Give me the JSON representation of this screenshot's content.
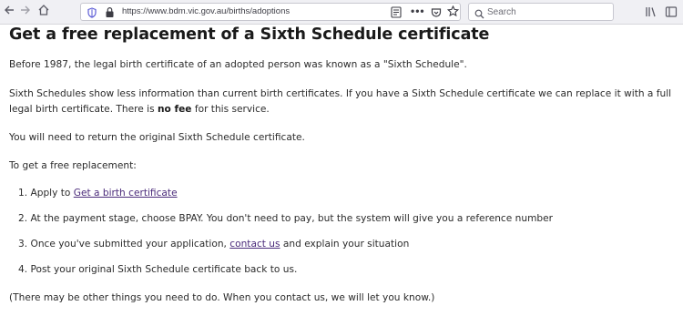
{
  "browser": {
    "url": "https://www.bdm.vic.gov.au/births/adoptions",
    "search_placeholder": "Search",
    "icons": [
      "back-icon",
      "forward-icon",
      "home-icon",
      "tracking-shield-icon",
      "lock-icon",
      "reader-view-icon",
      "page-actions-icon",
      "pocket-icon",
      "bookmark-star-icon",
      "search-icon",
      "library-icon",
      "sidebar-icon"
    ]
  },
  "page": {
    "title": "Get a free replacement of a Sixth Schedule certificate",
    "intro": "Before 1987, the legal birth certificate of an adopted person was known as a \"Sixth Schedule\".",
    "explain_before": "Sixth Schedules show less information than current birth certificates. If you have a Sixth Schedule certificate we can replace it with a full legal birth certificate. There is ",
    "explain_bold": "no fee",
    "explain_after": " for this service.",
    "return_note": "You will need to return the original Sixth Schedule certificate.",
    "steps_intro": "To get a free replacement:",
    "steps": [
      {
        "num": "1.",
        "before": "Apply to ",
        "link": "Get a birth certificate",
        "after": ""
      },
      {
        "num": "2.",
        "text": "At the payment stage, choose BPAY. You don't need to pay, but the system will give you a reference number"
      },
      {
        "num": "3.",
        "before": "Once you've submitted your application, ",
        "link": "contact us",
        "after": " and explain your situation"
      },
      {
        "num": "4.",
        "text": "Post your original Sixth Schedule certificate back to us."
      }
    ],
    "footer_note": "(There may be other things you need to do. When you contact us, we will let you know.)"
  },
  "colors": {
    "link": "#4a2a7a",
    "text": "#2b2b2b",
    "toolbar_bg": "#f0f0f4"
  }
}
